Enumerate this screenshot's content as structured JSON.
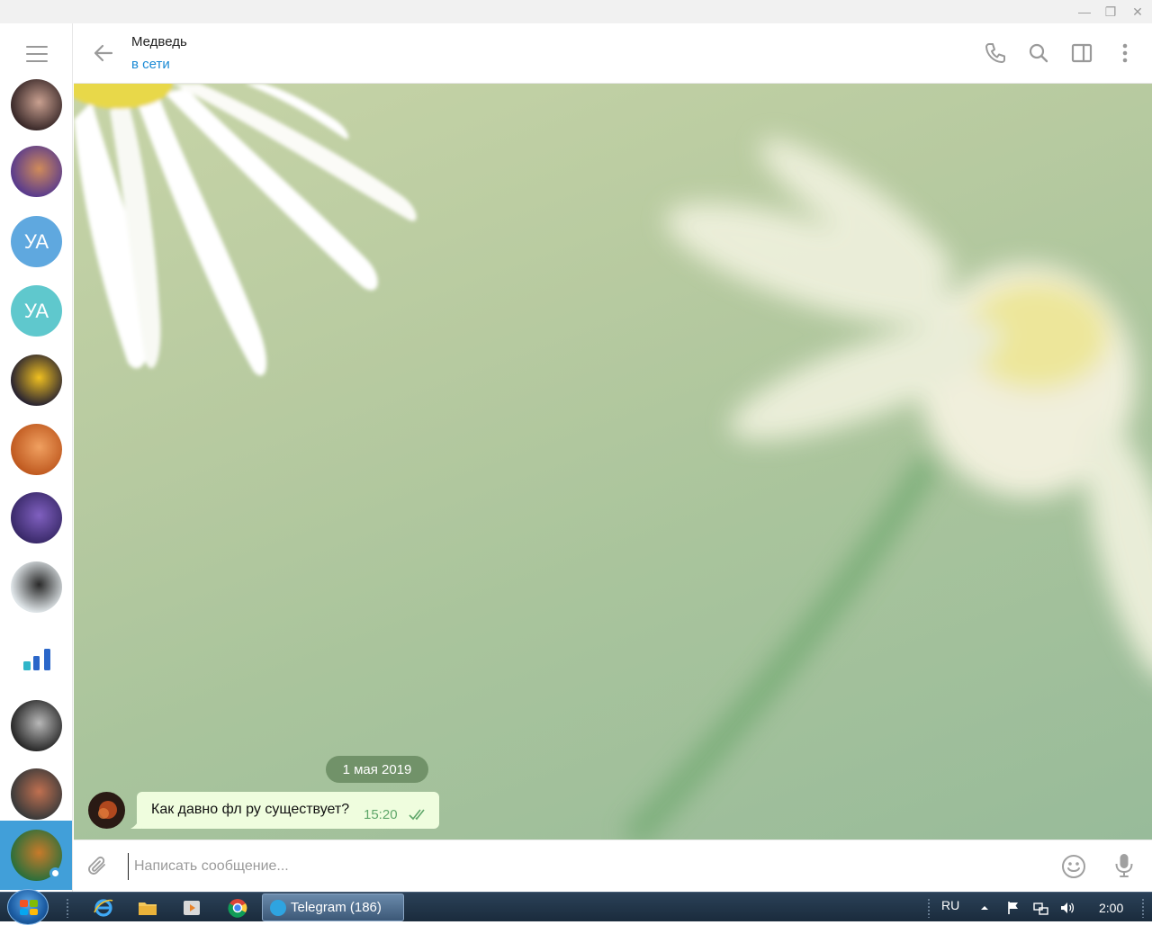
{
  "window": {
    "controls": {
      "minimize": "—",
      "maximize": "❐",
      "close": "✕"
    }
  },
  "sidebar": {
    "menu_icon": "hamburger-icon",
    "chats": [
      {
        "id": "chat-1",
        "type": "photo",
        "colors": [
          "#3b2a2a",
          "#c9a090"
        ]
      },
      {
        "id": "chat-2",
        "type": "photo",
        "colors": [
          "#5a3b8c",
          "#d08b5a"
        ]
      },
      {
        "id": "chat-3",
        "type": "initials",
        "initials": "УА",
        "color": "#5fa8df"
      },
      {
        "id": "chat-4",
        "type": "initials",
        "initials": "УА",
        "color": "#5fc8cd"
      },
      {
        "id": "chat-5",
        "type": "photo",
        "colors": [
          "#2b2530",
          "#f0c020"
        ]
      },
      {
        "id": "chat-6",
        "type": "photo",
        "colors": [
          "#c05a20",
          "#f0a060"
        ]
      },
      {
        "id": "chat-7",
        "type": "photo",
        "colors": [
          "#3a2a6a",
          "#8060c0"
        ]
      },
      {
        "id": "chat-8",
        "type": "photo",
        "colors": [
          "#dfe5e8",
          "#2a2a2a"
        ]
      },
      {
        "id": "chat-9",
        "type": "stats",
        "colors": [
          "#2fb5c9",
          "#2b67c9"
        ]
      },
      {
        "id": "chat-10",
        "type": "photo",
        "colors": [
          "#2a2a2a",
          "#b8b8b8"
        ]
      },
      {
        "id": "chat-11",
        "type": "photo",
        "colors": [
          "#3a3a3a",
          "#c07050"
        ]
      },
      {
        "id": "chat-12",
        "type": "photo",
        "colors": [
          "#2e6f3a",
          "#c77a2a"
        ],
        "active": true,
        "online": true
      }
    ]
  },
  "header": {
    "name": "Медведь",
    "status": "в сети",
    "icons": [
      "phone-icon",
      "search-icon",
      "sidebar-toggle-icon",
      "more-vertical-icon"
    ]
  },
  "messages": {
    "date_separator": "1 мая 2019",
    "items": [
      {
        "text": "Как давно фл ру существует?",
        "time": "15:20",
        "read": true,
        "outgoing": true
      }
    ]
  },
  "composer": {
    "placeholder": "Написать сообщение...",
    "value": ""
  },
  "taskbar": {
    "task_label": "Telegram (186)",
    "language": "RU",
    "clock": "2:00"
  },
  "colors": {
    "accent": "#419fd9",
    "status_online": "#1a8ad5",
    "bubble": "#effdde",
    "time_green": "#5fa76a",
    "date_pill": "#5d8056"
  }
}
